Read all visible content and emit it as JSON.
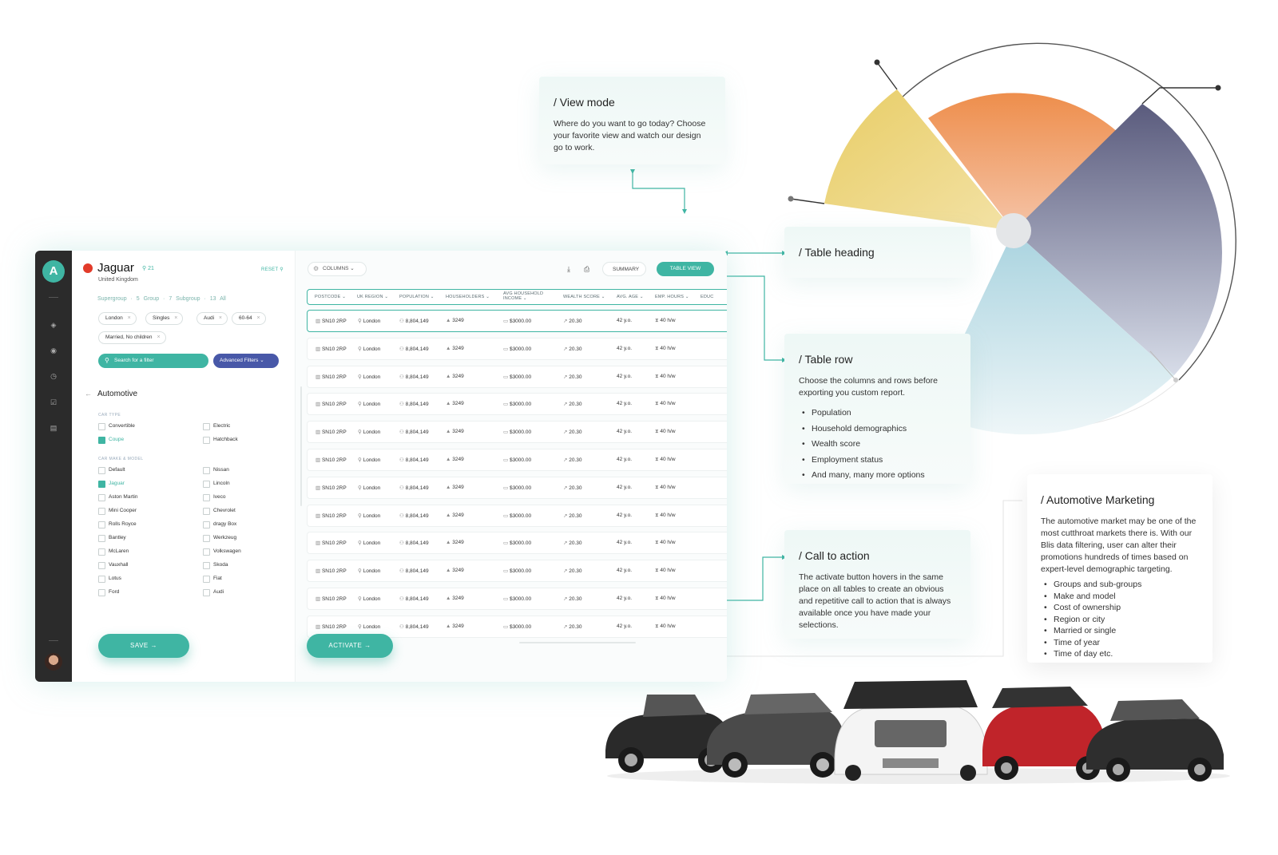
{
  "callouts": {
    "view_mode": {
      "title": "/ View mode",
      "text": "Where do you want to go today? Choose your favorite view and watch our design go to work."
    },
    "table_heading": {
      "title": "/ Table heading"
    },
    "table_row": {
      "title": "/ Table row",
      "text": "Choose the columns and rows before exporting you custom report.",
      "items": [
        "Population",
        "Household demographics",
        "Wealth score",
        "Employment status",
        "And many, many more options"
      ]
    },
    "call_to_action": {
      "title": "/ Call to action",
      "text": "The activate button hovers in the same place on all tables to create an obvious and repetitive call to action that is always available once you have made your selections."
    },
    "automotive_marketing": {
      "title": "/ Automotive Marketing",
      "text": "The automotive market may be one of the most cutthroat markets there is. With our Blis data filtering, user can alter their promotions hundreds of times based on expert-level demographic targeting.",
      "items": [
        "Groups and sub-groups",
        "Make and model",
        "Cost of ownership",
        "Region or city",
        "Married or single",
        "Time of year",
        "Time of day etc."
      ]
    }
  },
  "colors": {
    "accent": "#3fb5a3",
    "indigo": "#4858a8",
    "rail": "#2b2b2b",
    "pie_yellow": "#e8cf6e",
    "pie_orange": "#ee8f50",
    "pie_slate": "#5d5f80",
    "pie_blue": "#b9dbe6"
  },
  "app": {
    "logo": "A",
    "avatar_icon": "user-avatar",
    "filters": {
      "brand": "Jaguar",
      "brand_count": "⚲ 21",
      "country": "United Kingdom",
      "reset": "RESET ⚲",
      "crumbs": "Supergroup · 5   Group · 7   Subgroup · 13   All",
      "chips": [
        "London",
        "Singles",
        "Audi",
        "60-64",
        "Married, No children"
      ],
      "search_label": "Search for a filter",
      "advanced_label": "Advanced Filters ⌄",
      "section": "Automotive",
      "car_type_label": "CAR TYPE",
      "car_types_left": [
        "Convertible",
        "Coupe"
      ],
      "car_types_right": [
        "Electric",
        "Hatchback"
      ],
      "make_label": "CAR MAKE & MODEL",
      "makes_left": [
        "Default",
        "Jaguar",
        "Aston Martin",
        "Mini Cooper",
        "Rolls Royce",
        "Bantley",
        "McLaren",
        "Vauxhall",
        "Lotus",
        "Ford"
      ],
      "makes_right": [
        "Nissan",
        "Lincoln",
        "Iveco",
        "Chevrolet",
        "dragy Box",
        "Werkzeug",
        "Volkswagen",
        "Skoda",
        "Fiat",
        "Audi"
      ],
      "save_label": "SAVE →"
    },
    "table": {
      "columns_label": "COLUMNS ⌄",
      "summary_label": "SUMMARY",
      "table_view_label": "TABLE VIEW",
      "headers": [
        "POSTCODE ⌄",
        "UK REGION ⌄",
        "POPULATION ⌄",
        "HOUSEHOLDERS ⌄",
        "AVG HOUSEHOLD INCOME ⌄",
        "WEALTH SCORE ⌄",
        "AVG. AGE ⌄",
        "EMP. HOURS ⌄",
        "EDUC"
      ],
      "row": {
        "postcode": "SN10 2RP",
        "region": "London",
        "population": "8,804,149",
        "householders": "3249",
        "income": "$3000.00",
        "wealth": "20.30",
        "age": "42 y.o.",
        "hours": "40 h/w"
      },
      "row_count": 12,
      "activate_label": "ACTIVATE →"
    }
  }
}
